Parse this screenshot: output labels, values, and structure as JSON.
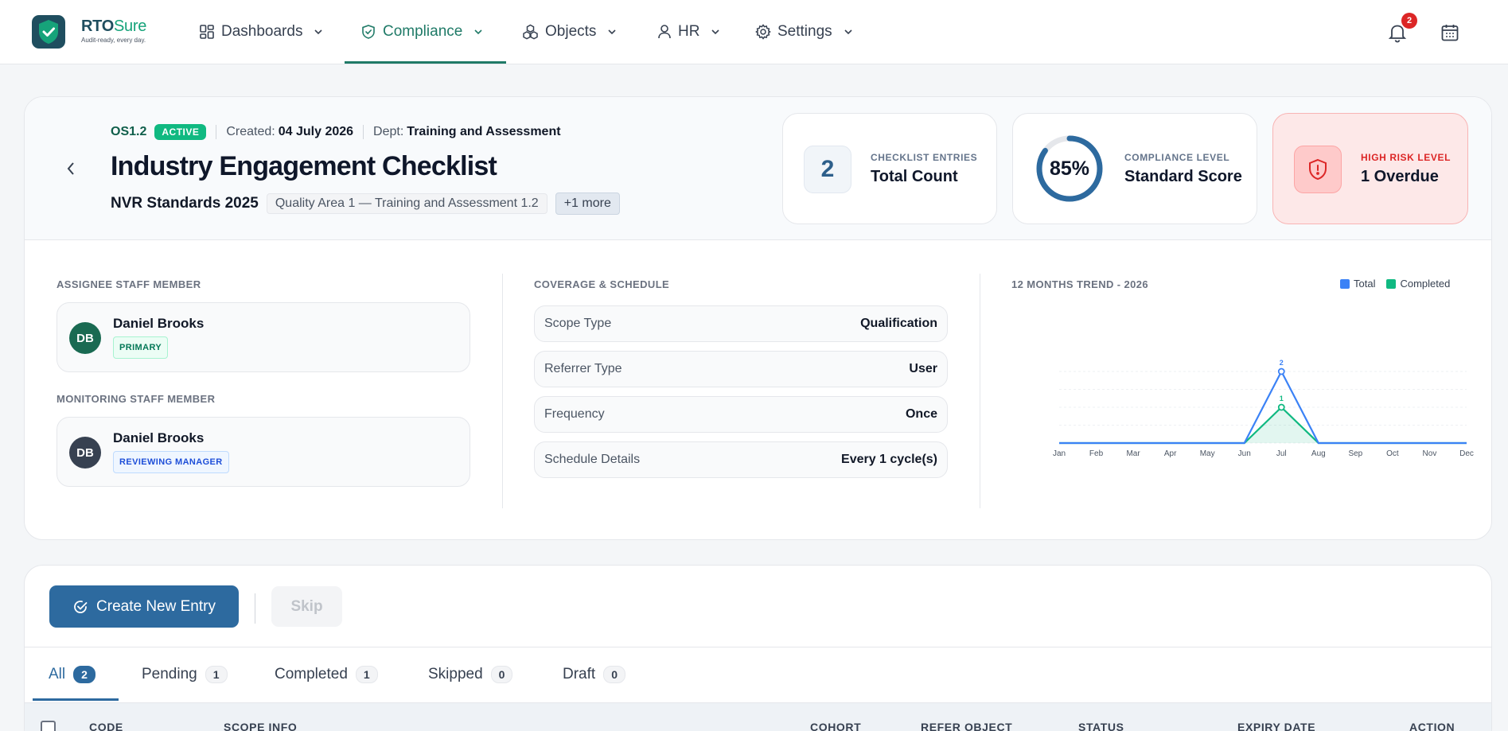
{
  "brand": {
    "name_bold": "RTO",
    "name_light": "Sure",
    "tagline": "Audit-ready, every day."
  },
  "nav": [
    {
      "label": "Dashboards",
      "icon": "grid-icon",
      "active": false
    },
    {
      "label": "Compliance",
      "icon": "shield-check-icon",
      "active": true
    },
    {
      "label": "Objects",
      "icon": "cubes-icon",
      "active": false
    },
    {
      "label": "HR",
      "icon": "user-icon",
      "active": false
    },
    {
      "label": "Settings",
      "icon": "gear-icon",
      "active": false
    }
  ],
  "notifications": {
    "count": "2"
  },
  "header": {
    "code": "OS1.2",
    "status": "ACTIVE",
    "created_label": "Created:",
    "created_value": "04 July 2026",
    "dept_label": "Dept:",
    "dept_value": "Training and Assessment",
    "title": "Industry Engagement Checklist",
    "standard": "NVR Standards 2025",
    "standard_chip": "Quality Area 1 — Training and Assessment 1.2",
    "more_chip": "+1 more"
  },
  "stats": {
    "entries": {
      "value": "2",
      "label": "CHECKLIST ENTRIES",
      "sub": "Total Count"
    },
    "compliance": {
      "percent": 85,
      "display": "85%",
      "label": "COMPLIANCE LEVEL",
      "sub": "Standard Score"
    },
    "risk": {
      "label": "HIGH RISK LEVEL",
      "sub": "1 Overdue"
    }
  },
  "assignee": {
    "section": "ASSIGNEE STAFF MEMBER",
    "initials": "DB",
    "name": "Daniel Brooks",
    "role": "PRIMARY"
  },
  "monitoring": {
    "section": "MONITORING STAFF MEMBER",
    "initials": "DB",
    "name": "Daniel Brooks",
    "role": "REVIEWING MANAGER"
  },
  "coverage": {
    "section": "COVERAGE & SCHEDULE",
    "rows": [
      {
        "key": "Scope Type",
        "value": "Qualification"
      },
      {
        "key": "Referrer Type",
        "value": "User"
      },
      {
        "key": "Frequency",
        "value": "Once"
      },
      {
        "key": "Schedule Details",
        "value": "Every 1 cycle(s)"
      }
    ]
  },
  "chart_data": {
    "type": "line",
    "title": "12 MONTHS TREND - 2026",
    "categories": [
      "Jan",
      "Feb",
      "Mar",
      "Apr",
      "May",
      "Jun",
      "Jul",
      "Aug",
      "Sep",
      "Oct",
      "Nov",
      "Dec"
    ],
    "series": [
      {
        "name": "Total",
        "color": "#3b82f6",
        "values": [
          0,
          0,
          0,
          0,
          0,
          0,
          2,
          0,
          0,
          0,
          0,
          0
        ]
      },
      {
        "name": "Completed",
        "color": "#10b981",
        "values": [
          0,
          0,
          0,
          0,
          0,
          0,
          1,
          0,
          0,
          0,
          0,
          0
        ]
      }
    ],
    "ylim": [
      0,
      2
    ],
    "grid": true,
    "legend": "top-right"
  },
  "actions": {
    "create": "Create New Entry",
    "skip": "Skip"
  },
  "tabs": [
    {
      "label": "All",
      "count": "2",
      "active": true
    },
    {
      "label": "Pending",
      "count": "1",
      "active": false
    },
    {
      "label": "Completed",
      "count": "1",
      "active": false
    },
    {
      "label": "Skipped",
      "count": "0",
      "active": false
    },
    {
      "label": "Draft",
      "count": "0",
      "active": false
    }
  ],
  "table": {
    "columns": [
      "CODE",
      "SCOPE INFO",
      "COHORT",
      "REFER OBJECT",
      "STATUS",
      "EXPIRY DATE",
      "ACTION"
    ]
  }
}
